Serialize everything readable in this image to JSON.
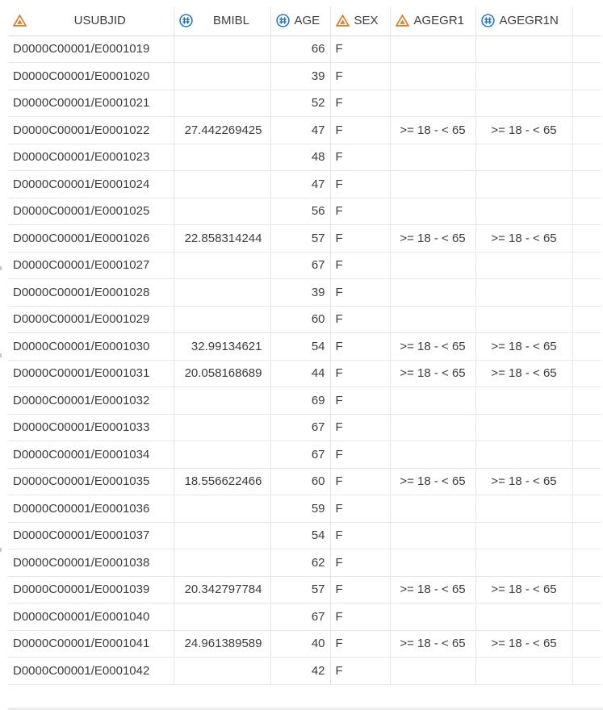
{
  "columns": [
    {
      "key": "usubjid",
      "label": "USUBJID",
      "type": "char",
      "icon": "char-triangle-icon"
    },
    {
      "key": "bmibl",
      "label": "BMIBL",
      "type": "num",
      "icon": "num-hash-icon"
    },
    {
      "key": "age",
      "label": "AGE",
      "type": "num",
      "icon": "num-hash-icon"
    },
    {
      "key": "sex",
      "label": "SEX",
      "type": "char",
      "icon": "char-triangle-icon"
    },
    {
      "key": "agegr1",
      "label": "AGEGR1",
      "type": "char",
      "icon": "char-triangle-icon"
    },
    {
      "key": "agegr1n",
      "label": "AGEGR1N",
      "type": "num",
      "icon": "num-hash-icon"
    }
  ],
  "colors": {
    "char_icon": "#e07b2a",
    "num_icon": "#1f6fc2",
    "grid_line": "#e6e6e6",
    "text": "#3c3c3c"
  },
  "rows": [
    {
      "usubjid": "D0000C00001/E0001019",
      "bmibl": "",
      "age": "66",
      "sex": "F",
      "agegr1": "",
      "agegr1n": ""
    },
    {
      "usubjid": "D0000C00001/E0001020",
      "bmibl": "",
      "age": "39",
      "sex": "F",
      "agegr1": "",
      "agegr1n": ""
    },
    {
      "usubjid": "D0000C00001/E0001021",
      "bmibl": "",
      "age": "52",
      "sex": "F",
      "agegr1": "",
      "agegr1n": ""
    },
    {
      "usubjid": "D0000C00001/E0001022",
      "bmibl": "27.442269425",
      "age": "47",
      "sex": "F",
      "agegr1": ">= 18 - < 65",
      "agegr1n": ">= 18 - < 65"
    },
    {
      "usubjid": "D0000C00001/E0001023",
      "bmibl": "",
      "age": "48",
      "sex": "F",
      "agegr1": "",
      "agegr1n": ""
    },
    {
      "usubjid": "D0000C00001/E0001024",
      "bmibl": "",
      "age": "47",
      "sex": "F",
      "agegr1": "",
      "agegr1n": ""
    },
    {
      "usubjid": "D0000C00001/E0001025",
      "bmibl": "",
      "age": "56",
      "sex": "F",
      "agegr1": "",
      "agegr1n": ""
    },
    {
      "usubjid": "D0000C00001/E0001026",
      "bmibl": "22.858314244",
      "age": "57",
      "sex": "F",
      "agegr1": ">= 18 - < 65",
      "agegr1n": ">= 18 - < 65"
    },
    {
      "usubjid": "D0000C00001/E0001027",
      "bmibl": "",
      "age": "67",
      "sex": "F",
      "agegr1": "",
      "agegr1n": ""
    },
    {
      "usubjid": "D0000C00001/E0001028",
      "bmibl": "",
      "age": "39",
      "sex": "F",
      "agegr1": "",
      "agegr1n": ""
    },
    {
      "usubjid": "D0000C00001/E0001029",
      "bmibl": "",
      "age": "60",
      "sex": "F",
      "agegr1": "",
      "agegr1n": ""
    },
    {
      "usubjid": "D0000C00001/E0001030",
      "bmibl": "32.99134621",
      "age": "54",
      "sex": "F",
      "agegr1": ">= 18 - < 65",
      "agegr1n": ">= 18 - < 65"
    },
    {
      "usubjid": "D0000C00001/E0001031",
      "bmibl": "20.058168689",
      "age": "44",
      "sex": "F",
      "agegr1": ">= 18 - < 65",
      "agegr1n": ">= 18 - < 65"
    },
    {
      "usubjid": "D0000C00001/E0001032",
      "bmibl": "",
      "age": "69",
      "sex": "F",
      "agegr1": "",
      "agegr1n": ""
    },
    {
      "usubjid": "D0000C00001/E0001033",
      "bmibl": "",
      "age": "67",
      "sex": "F",
      "agegr1": "",
      "agegr1n": ""
    },
    {
      "usubjid": "D0000C00001/E0001034",
      "bmibl": "",
      "age": "67",
      "sex": "F",
      "agegr1": "",
      "agegr1n": ""
    },
    {
      "usubjid": "D0000C00001/E0001035",
      "bmibl": "18.556622466",
      "age": "60",
      "sex": "F",
      "agegr1": ">= 18 - < 65",
      "agegr1n": ">= 18 - < 65"
    },
    {
      "usubjid": "D0000C00001/E0001036",
      "bmibl": "",
      "age": "59",
      "sex": "F",
      "agegr1": "",
      "agegr1n": ""
    },
    {
      "usubjid": "D0000C00001/E0001037",
      "bmibl": "",
      "age": "54",
      "sex": "F",
      "agegr1": "",
      "agegr1n": ""
    },
    {
      "usubjid": "D0000C00001/E0001038",
      "bmibl": "",
      "age": "62",
      "sex": "F",
      "agegr1": "",
      "agegr1n": ""
    },
    {
      "usubjid": "D0000C00001/E0001039",
      "bmibl": "20.342797784",
      "age": "57",
      "sex": "F",
      "agegr1": ">= 18 - < 65",
      "agegr1n": ">= 18 - < 65"
    },
    {
      "usubjid": "D0000C00001/E0001040",
      "bmibl": "",
      "age": "67",
      "sex": "F",
      "agegr1": "",
      "agegr1n": ""
    },
    {
      "usubjid": "D0000C00001/E0001041",
      "bmibl": "24.961389589",
      "age": "40",
      "sex": "F",
      "agegr1": ">= 18 - < 65",
      "agegr1n": ">= 18 - < 65"
    },
    {
      "usubjid": "D0000C00001/E0001042",
      "bmibl": "",
      "age": "42",
      "sex": "F",
      "agegr1": "",
      "agegr1n": ""
    }
  ]
}
